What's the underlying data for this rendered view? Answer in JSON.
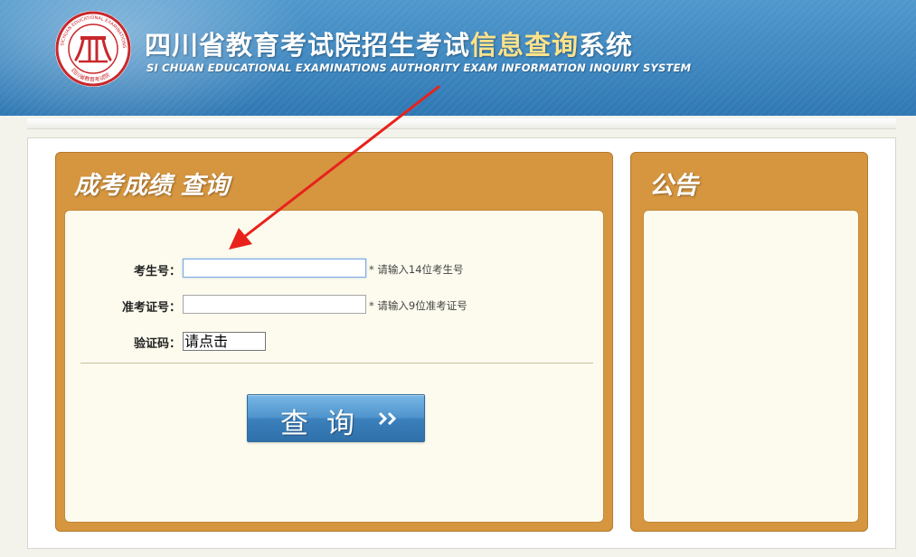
{
  "header": {
    "title_main": "四川省教育考试院招生考试",
    "title_highlight": "信息查询",
    "title_tail": "系统",
    "subtitle": "SI CHUAN EDUCATIONAL EXAMINATIONS AUTHORITY EXAM INFORMATION INQUIRY SYSTEM",
    "seal_text": "SICHUAN EDUCATIONAL EXAMINATIONS AUTHORITY",
    "seal_text_cn": "四川省教育考试院"
  },
  "query_panel": {
    "title": "成考成绩  查询",
    "exam_no": {
      "label": "考生号：",
      "value": "",
      "hint": "* 请输入14位考生号"
    },
    "admission_no": {
      "label": "准考证号：",
      "value": "",
      "hint": "* 请输入9位准考证号"
    },
    "captcha": {
      "label": "验证码：",
      "text": "请点击"
    },
    "submit_label": "查询"
  },
  "notice_panel": {
    "title": "公告"
  },
  "colors": {
    "header_blue": "#3e87c0",
    "panel_orange": "#d6963f",
    "inner_bg": "#fcfbee",
    "button_blue": "#3b80bc",
    "arrow_red": "#e8221b",
    "title_highlight": "#fde28b",
    "seal_red": "#c8282c"
  }
}
